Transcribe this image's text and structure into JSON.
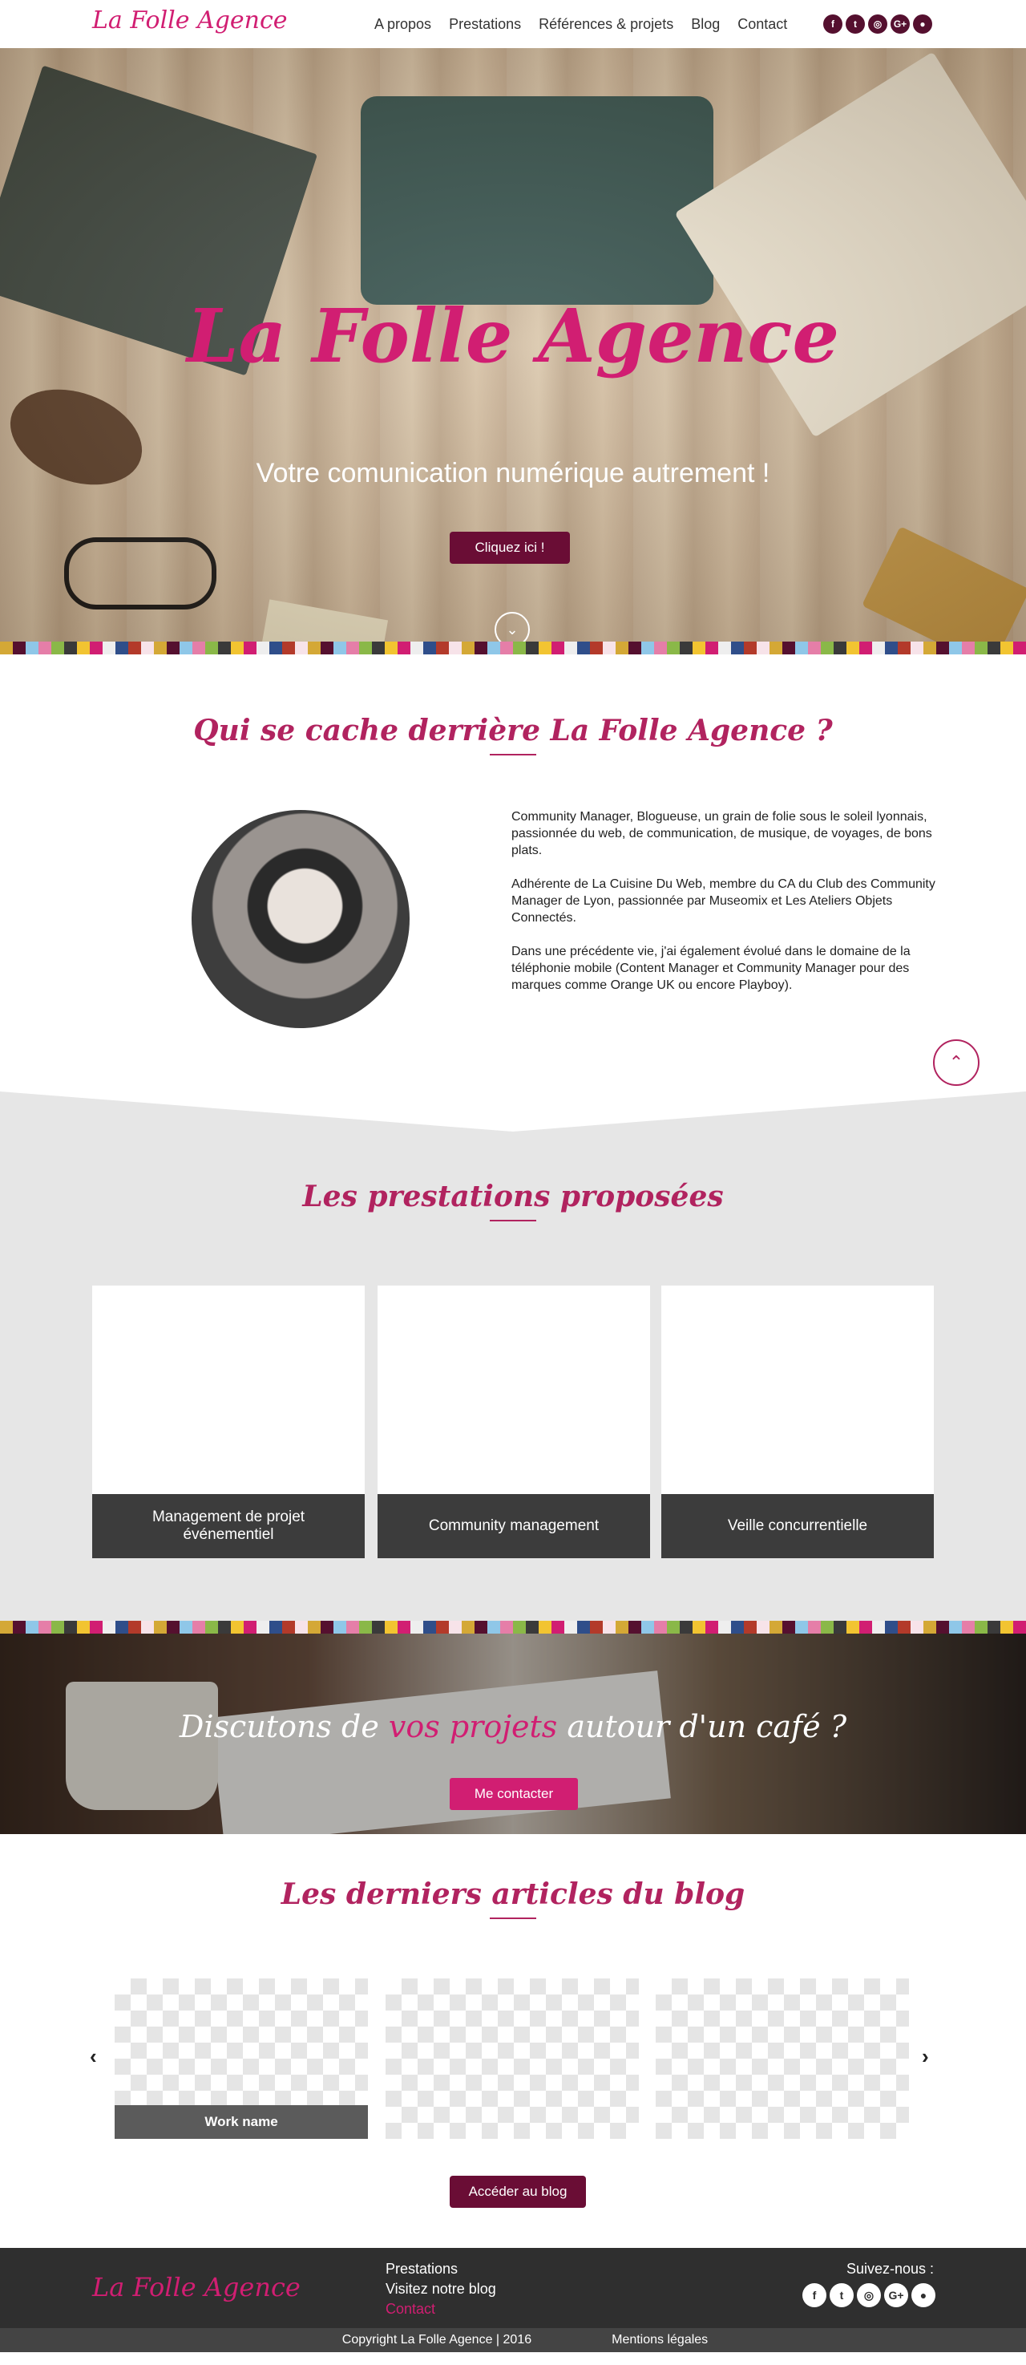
{
  "nav": {
    "logo": "La Folle Agence",
    "items": [
      "A propos",
      "Prestations",
      "Références & projets",
      "Blog",
      "Contact"
    ],
    "social_icons": [
      "facebook-icon",
      "twitter-icon",
      "instagram-icon",
      "google-plus-icon",
      "user-icon"
    ],
    "social_glyphs": [
      "f",
      "t",
      "◎",
      "G+",
      "●"
    ]
  },
  "hero": {
    "title": "La Folle Agence",
    "subtitle": "Votre comunication numérique autrement !",
    "cta_label": "Cliquez ici !",
    "scroll_glyph": "⌄"
  },
  "about": {
    "title": "Qui se cache derrière La Folle Agence ?",
    "paragraphs": [
      "Community Manager, Blogueuse, un grain de folie sous le soleil lyonnais, passionnée du web, de communication, de musique, de voyages, de bons plats.",
      "Adhérente de La Cuisine Du Web, membre du CA du Club des Community Manager de Lyon, passionnée par Museomix et Les Ateliers Objets Connectés.",
      "Dans une précédente vie, j'ai également évolué dans le domaine de la téléphonie mobile (Content Manager et Community Manager pour des marques comme Orange UK ou encore Playboy)."
    ],
    "up_glyph": "⌃"
  },
  "services": {
    "title": "Les prestations proposées",
    "cards": [
      "Management de projet événementiel",
      "Community management",
      "Veille concurrentielle"
    ]
  },
  "coffee": {
    "tagline_before": "Discutons de ",
    "tagline_highlight": "vos projets",
    "tagline_after": " autour d'un café ?",
    "button": "Me contacter"
  },
  "blog": {
    "title": "Les derniers articles du blog",
    "caption": "Work name",
    "prev_glyph": "‹",
    "next_glyph": "›",
    "button": "Accéder au blog"
  },
  "footer": {
    "logo": "La Folle Agence",
    "links": [
      "Prestations",
      "Visitez notre blog",
      "Contact"
    ],
    "follow": "Suivez-nous :",
    "social_glyphs": [
      "f",
      "t",
      "◎",
      "G+",
      "●"
    ]
  },
  "bottom": {
    "copyright": "Copyright La Folle Agence | 2016",
    "legal": "Mentions légales"
  },
  "colors": {
    "accent": "#d11e72",
    "dark_accent": "#6a0d35",
    "title": "#b1235f"
  }
}
